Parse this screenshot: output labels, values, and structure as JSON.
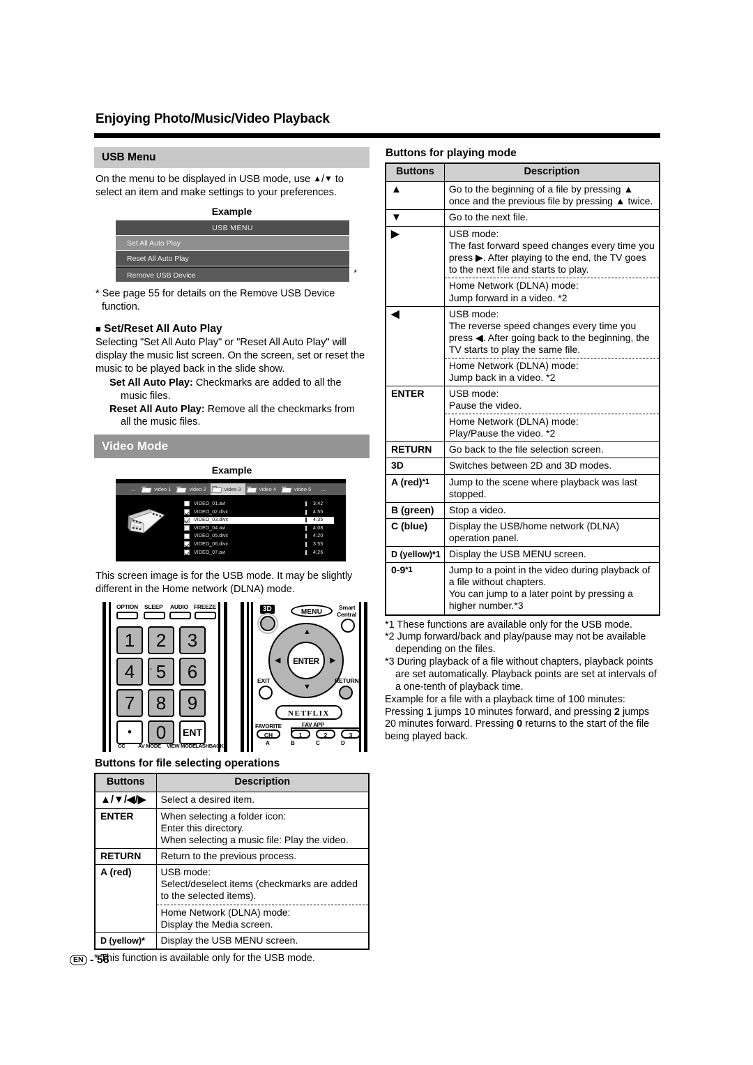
{
  "document": {
    "title": "Enjoying Photo/Music/Video Playback",
    "page_number": "56",
    "page_locale": "EN",
    "page_separator": "-"
  },
  "left_column": {
    "usb_menu": {
      "heading": "USB Menu",
      "intro": "On the menu to be displayed in USB mode, use ▲/▼ to select an item and make settings to your preferences.",
      "example_label": "Example",
      "screen": {
        "header": "USB MENU",
        "items": [
          {
            "label": "Set All Auto Play",
            "state": "selected"
          },
          {
            "label": "Reset All Auto Play",
            "state": "normal"
          },
          {
            "label": "Remove USB Device",
            "state": "normal"
          }
        ],
        "footnote_marker": "*"
      },
      "footnote": "* See page 55 for details on the Remove USB Device function."
    },
    "set_reset": {
      "heading_marker": "■",
      "heading": "Set/Reset All Auto Play",
      "body": "Selecting \"Set All Auto Play\" or \"Reset All Auto Play\" will display the music list screen. On the screen, set or reset the music to be played back in the slide show.",
      "items": [
        {
          "term": "Set All Auto Play:",
          "desc": "Checkmarks are added to all the",
          "cont": "music files."
        },
        {
          "term": "Reset All Auto Play:",
          "desc": "Remove all the checkmarks from",
          "cont": "all the music files."
        }
      ]
    },
    "video_mode": {
      "heading": "Video Mode",
      "example_label": "Example",
      "screen": {
        "leading_ellipsis": "...",
        "trailing_ellipsis": "...",
        "tabs": [
          {
            "label": "video 1",
            "active": false
          },
          {
            "label": "video 2",
            "active": false
          },
          {
            "label": "video 3",
            "active": true
          },
          {
            "label": "video 4",
            "active": false
          },
          {
            "label": "video 5",
            "active": false
          }
        ],
        "files": [
          {
            "name": "VIDEO_01.avi",
            "time": "3:42",
            "checked": false,
            "selected": false
          },
          {
            "name": "VIDEO_02.divx",
            "time": "4:55",
            "checked": true,
            "selected": false
          },
          {
            "name": "VIDEO_03.divx",
            "time": "4:35",
            "checked": true,
            "selected": true
          },
          {
            "name": "VIDEO_04.avi",
            "time": "4:08",
            "checked": false,
            "selected": false
          },
          {
            "name": "VIDEO_05.divx",
            "time": "4:20",
            "checked": false,
            "selected": false
          },
          {
            "name": "VIDEO_06.divx",
            "time": "3:55",
            "checked": true,
            "selected": false
          },
          {
            "name": "VIDEO_07.avi",
            "time": "4:26",
            "checked": true,
            "selected": false
          }
        ]
      },
      "caption": "This screen image is for the USB mode. It may be slightly different in the Home network (DLNA) mode."
    },
    "remote": {
      "top_labels": [
        "OPTION",
        "SLEEP",
        "AUDIO",
        "FREEZE"
      ],
      "keypad": [
        "1",
        "2",
        "3",
        "4",
        "5",
        "6",
        "7",
        "8",
        "9",
        "•",
        "0",
        "ENT"
      ],
      "bottom_labels": [
        "CC",
        "AV MODE",
        "VIEW MODE",
        "FLASHBACK"
      ],
      "three_d": "3D",
      "menu": "MENU",
      "smart_central_line1": "Smart",
      "smart_central_line2": "Central",
      "enter": "ENTER",
      "exit": "EXIT",
      "return": "RETURN",
      "netflix": "NETFLIX",
      "favorite": "FAVORITE",
      "favorite_ch": "CH",
      "fav_app": "FAV APP",
      "fav_app_nums": [
        "1",
        "2",
        "3"
      ],
      "color_labels": [
        "A",
        "B",
        "C",
        "D"
      ]
    },
    "file_table": {
      "title": "Buttons for file selecting operations",
      "headers": [
        "Buttons",
        "Description"
      ],
      "rows": [
        {
          "key": "▲/▼/◀/▶",
          "key_style": "glyph",
          "lines": [
            "Select a desired item."
          ]
        },
        {
          "key": "ENTER",
          "lines": [
            "When selecting a folder icon:",
            "Enter this directory.",
            "When selecting a music file: Play the video."
          ]
        },
        {
          "key": "RETURN",
          "lines": [
            "Return to the previous process."
          ]
        },
        {
          "key": "A (red)",
          "sub_blocks": [
            {
              "lines": [
                "USB mode:",
                "Select/deselect items (checkmarks are added",
                "to the selected items)."
              ]
            },
            {
              "lines": [
                "Home Network (DLNA) mode:",
                "Display the Media screen."
              ]
            }
          ]
        },
        {
          "key": "D (yellow)*",
          "key_style": "small",
          "lines": [
            "Display the USB MENU screen."
          ]
        }
      ],
      "footnote": "* This function is available only for the USB mode."
    }
  },
  "right_column": {
    "playing_table": {
      "title": "Buttons for playing mode",
      "headers": [
        "Buttons",
        "Description"
      ],
      "rows": [
        {
          "key": "▲",
          "key_style": "glyph",
          "lines": [
            "Go to the beginning of a file by pressing ▲",
            "once and the previous file by pressing ▲ twice."
          ]
        },
        {
          "key": "▼",
          "key_style": "glyph",
          "lines": [
            "Go to the next file."
          ]
        },
        {
          "key": "▶",
          "key_style": "glyph",
          "sub_blocks": [
            {
              "lines": [
                "USB mode:",
                "The fast forward speed changes every time you",
                "press ▶. After playing to the end, the TV goes",
                "to the next file and starts to play."
              ]
            },
            {
              "lines": [
                "Home Network (DLNA) mode:",
                "Jump forward in a video. *2"
              ]
            }
          ]
        },
        {
          "key": "◀",
          "key_style": "glyph",
          "sub_blocks": [
            {
              "lines": [
                "USB mode:",
                "The reverse speed changes every time you",
                "press ◀. After going back to the beginning, the",
                "TV starts to play the same file."
              ]
            },
            {
              "lines": [
                "Home Network (DLNA) mode:",
                "Jump back in a video. *2"
              ]
            }
          ]
        },
        {
          "key": "ENTER",
          "sub_blocks": [
            {
              "lines": [
                "USB mode:",
                "Pause the video."
              ]
            },
            {
              "lines": [
                "Home Network (DLNA) mode:",
                "Play/Pause the video. *2"
              ]
            }
          ]
        },
        {
          "key": "RETURN",
          "lines": [
            "Go back to the file selection screen."
          ]
        },
        {
          "key": "3D",
          "lines": [
            "Switches between 2D and 3D modes."
          ]
        },
        {
          "key": "A (red)*1",
          "lines": [
            "Jump to the scene where playback was last",
            "stopped."
          ]
        },
        {
          "key": "B (green)",
          "lines": [
            "Stop a video."
          ]
        },
        {
          "key": "C (blue)",
          "lines": [
            "Display the USB/home network (DLNA)",
            "operation panel."
          ]
        },
        {
          "key": "D (yellow)*1",
          "key_style": "small",
          "lines": [
            "Display the USB MENU screen."
          ]
        },
        {
          "key": "0-9*1",
          "lines": [
            "Jump to a point in the video during playback of",
            "a file without chapters.",
            "You can jump to a later point by pressing a",
            "higher number.*3"
          ]
        }
      ]
    },
    "footnotes": [
      "*1 These functions are available only for the USB mode.",
      "*2 Jump forward/back and play/pause may not be available depending on the files.",
      "*3 During playback of a file without chapters, playback points are set automatically. Playback points are set at intervals of a one-tenth of playback time."
    ],
    "example_text_1": "Example for a file with a playback time of 100 minutes:",
    "example_text_2": "Pressing 1 jumps 10 minutes forward, and pressing 2 jumps 20 minutes forward. Pressing 0 returns to the start of the file being played back."
  }
}
